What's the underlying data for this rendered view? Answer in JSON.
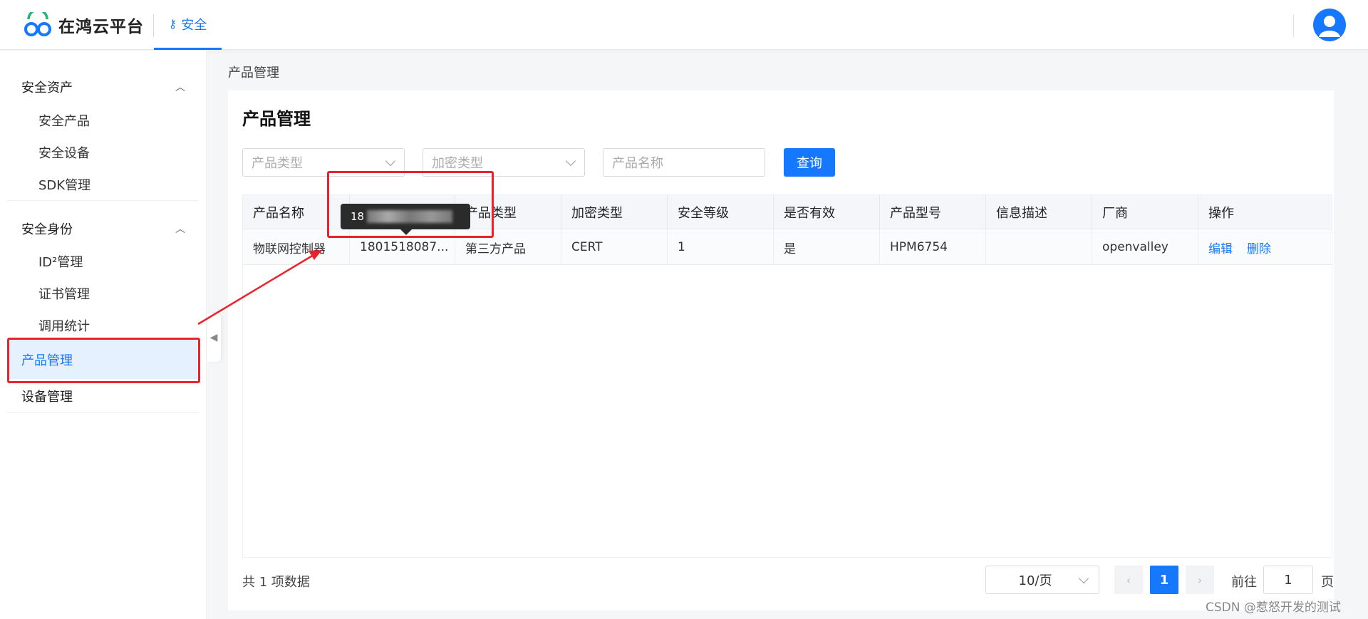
{
  "header": {
    "logo_text": "在鸿云平台",
    "nav_tab": "安全",
    "avatar_label": "user-avatar"
  },
  "sidebar": {
    "groups": [
      {
        "title": "安全资产",
        "items": [
          "安全产品",
          "安全设备",
          "SDK管理"
        ]
      },
      {
        "title": "安全身份",
        "items": [
          "ID²管理",
          "证书管理",
          "调用统计"
        ]
      }
    ],
    "active_item": "产品管理",
    "plain_item": "设备管理"
  },
  "breadcrumb": "产品管理",
  "page_title": "产品管理",
  "filters": {
    "product_type_placeholder": "产品类型",
    "encryption_type_placeholder": "加密类型",
    "product_name_placeholder": "产品名称",
    "query_label": "查询"
  },
  "table": {
    "columns": [
      "产品名称",
      "",
      "产品类型",
      "加密类型",
      "安全等级",
      "是否有效",
      "产品型号",
      "信息描述",
      "厂商",
      "操作"
    ],
    "rows": [
      {
        "product_name": "物联网控制器",
        "product_id": "1801518087...",
        "product_type": "第三方产品",
        "encryption_type": "CERT",
        "security_level": "1",
        "is_valid": "是",
        "model": "HPM6754",
        "description": "",
        "vendor": "openvalley",
        "edit": "编辑",
        "delete": "删除"
      }
    ]
  },
  "tooltip": {
    "prefix": "18"
  },
  "pagination": {
    "total": "共 1 项数据",
    "page_size": "10/页",
    "prev": "‹",
    "current": "1",
    "next": "›",
    "goto_label": "前往",
    "goto_value": "1",
    "goto_suffix": "页"
  },
  "watermark": "CSDN @惹怒开发的测试",
  "colors": {
    "accent": "#1677ff",
    "annotation": "#e8232b"
  }
}
